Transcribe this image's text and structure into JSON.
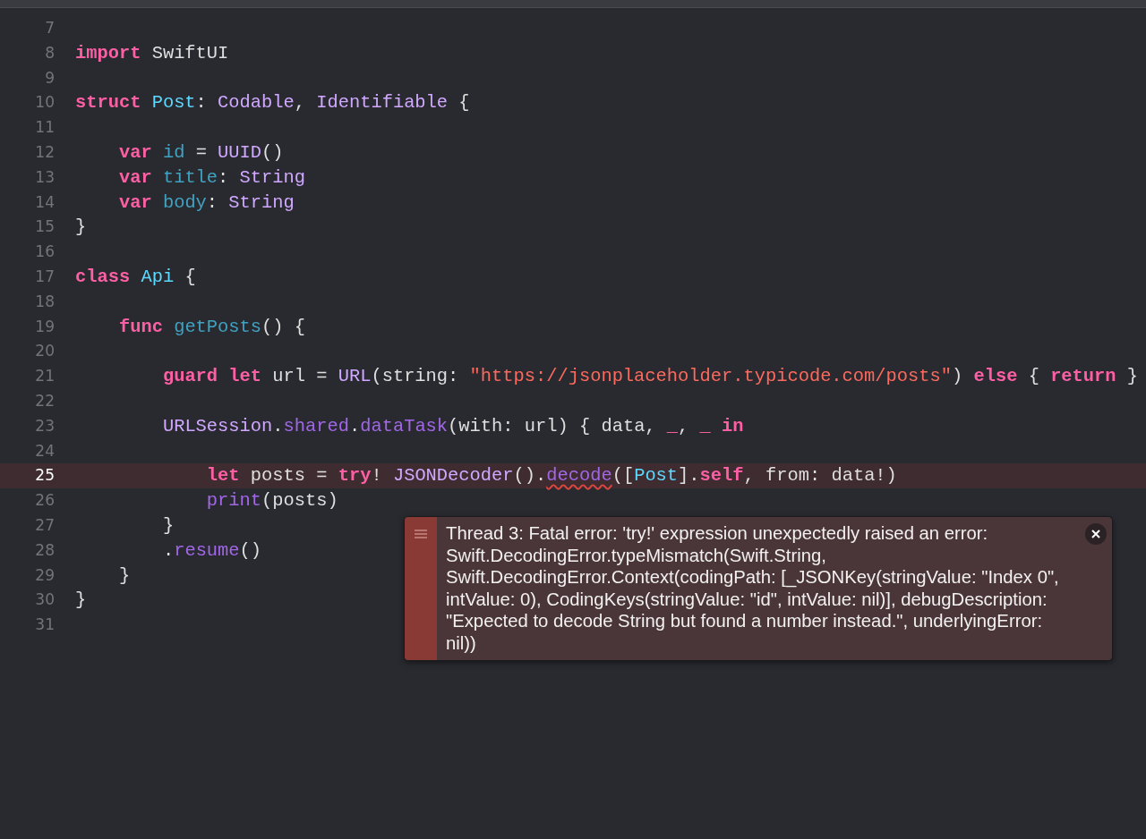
{
  "editor": {
    "lines": [
      {
        "number": "7",
        "highlighted": false
      },
      {
        "number": "8",
        "highlighted": false,
        "tokens": [
          {
            "text": "import ",
            "kind": "kw"
          },
          {
            "text": "SwiftUI",
            "kind": "plain"
          }
        ]
      },
      {
        "number": "9",
        "highlighted": false
      },
      {
        "number": "10",
        "highlighted": false,
        "tokens": [
          {
            "text": "struct ",
            "kind": "kw"
          },
          {
            "text": "Post",
            "kind": "ptype"
          },
          {
            "text": ": ",
            "kind": "plain"
          },
          {
            "text": "Codable",
            "kind": "type"
          },
          {
            "text": ", ",
            "kind": "plain"
          },
          {
            "text": "Identifiable",
            "kind": "type"
          },
          {
            "text": " {",
            "kind": "plain"
          }
        ]
      },
      {
        "number": "11",
        "highlighted": false
      },
      {
        "number": "12",
        "highlighted": false,
        "tokens": [
          {
            "text": "    var ",
            "kind": "kw"
          },
          {
            "text": "id",
            "kind": "decl"
          },
          {
            "text": " = ",
            "kind": "plain"
          },
          {
            "text": "UUID",
            "kind": "type"
          },
          {
            "text": "()",
            "kind": "plain"
          }
        ]
      },
      {
        "number": "13",
        "highlighted": false,
        "tokens": [
          {
            "text": "    var ",
            "kind": "kw"
          },
          {
            "text": "title",
            "kind": "decl"
          },
          {
            "text": ": ",
            "kind": "plain"
          },
          {
            "text": "String",
            "kind": "type"
          }
        ]
      },
      {
        "number": "14",
        "highlighted": false,
        "tokens": [
          {
            "text": "    var ",
            "kind": "kw"
          },
          {
            "text": "body",
            "kind": "decl"
          },
          {
            "text": ": ",
            "kind": "plain"
          },
          {
            "text": "String",
            "kind": "type"
          }
        ]
      },
      {
        "number": "15",
        "highlighted": false,
        "tokens": [
          {
            "text": "}",
            "kind": "plain"
          }
        ]
      },
      {
        "number": "16",
        "highlighted": false
      },
      {
        "number": "17",
        "highlighted": false,
        "tokens": [
          {
            "text": "class ",
            "kind": "kw"
          },
          {
            "text": "Api",
            "kind": "ptype"
          },
          {
            "text": " {",
            "kind": "plain"
          }
        ]
      },
      {
        "number": "18",
        "highlighted": false
      },
      {
        "number": "19",
        "highlighted": false,
        "tokens": [
          {
            "text": "    func ",
            "kind": "kw"
          },
          {
            "text": "getPosts",
            "kind": "decl"
          },
          {
            "text": "() {",
            "kind": "plain"
          }
        ]
      },
      {
        "number": "20",
        "highlighted": false
      },
      {
        "number": "21",
        "highlighted": false,
        "tokens": [
          {
            "text": "        guard let",
            "kind": "kw"
          },
          {
            "text": " url = ",
            "kind": "plain"
          },
          {
            "text": "URL",
            "kind": "type"
          },
          {
            "text": "(string: ",
            "kind": "plain"
          },
          {
            "text": "\"https://jsonplaceholder.typicode.com/posts\"",
            "kind": "str"
          },
          {
            "text": ") ",
            "kind": "plain"
          },
          {
            "text": "else",
            "kind": "kw"
          },
          {
            "text": " { ",
            "kind": "plain"
          },
          {
            "text": "return",
            "kind": "kw"
          },
          {
            "text": " }",
            "kind": "plain"
          }
        ]
      },
      {
        "number": "22",
        "highlighted": false
      },
      {
        "number": "23",
        "highlighted": false,
        "tokens": [
          {
            "text": "        URLSession",
            "kind": "type"
          },
          {
            "text": ".",
            "kind": "plain"
          },
          {
            "text": "shared",
            "kind": "method"
          },
          {
            "text": ".",
            "kind": "plain"
          },
          {
            "text": "dataTask",
            "kind": "method"
          },
          {
            "text": "(with: url) { data, ",
            "kind": "plain"
          },
          {
            "text": "_",
            "kind": "kw"
          },
          {
            "text": ", ",
            "kind": "plain"
          },
          {
            "text": "_ in",
            "kind": "kw"
          }
        ]
      },
      {
        "number": "24",
        "highlighted": false
      },
      {
        "number": "25",
        "highlighted": true,
        "tokens": [
          {
            "text": "            let",
            "kind": "kw"
          },
          {
            "text": " posts = ",
            "kind": "plain"
          },
          {
            "text": "try",
            "kind": "kw"
          },
          {
            "text": "! ",
            "kind": "plain"
          },
          {
            "text": "JSONDecoder",
            "kind": "type"
          },
          {
            "text": "().",
            "kind": "plain"
          },
          {
            "text": "decode",
            "kind": "method",
            "flagged": true
          },
          {
            "text": "([",
            "kind": "plain"
          },
          {
            "text": "Post",
            "kind": "ptype"
          },
          {
            "text": "].",
            "kind": "plain"
          },
          {
            "text": "self",
            "kind": "kw"
          },
          {
            "text": ", from: data!)",
            "kind": "plain"
          }
        ]
      },
      {
        "number": "26",
        "highlighted": false,
        "tokens": [
          {
            "text": "            print",
            "kind": "method"
          },
          {
            "text": "(posts)",
            "kind": "plain"
          }
        ]
      },
      {
        "number": "27",
        "highlighted": false,
        "tokens": [
          {
            "text": "        }",
            "kind": "plain"
          }
        ]
      },
      {
        "number": "28",
        "highlighted": false,
        "tokens": [
          {
            "text": "        .",
            "kind": "plain"
          },
          {
            "text": "resume",
            "kind": "method"
          },
          {
            "text": "()",
            "kind": "plain"
          }
        ]
      },
      {
        "number": "29",
        "highlighted": false,
        "tokens": [
          {
            "text": "    }",
            "kind": "plain"
          }
        ]
      },
      {
        "number": "30",
        "highlighted": false,
        "tokens": [
          {
            "text": "}",
            "kind": "plain"
          }
        ]
      },
      {
        "number": "31",
        "highlighted": false
      }
    ]
  },
  "error_popup": {
    "message": "Thread 3: Fatal error: 'try!' expression unexpectedly raised an error: Swift.DecodingError.typeMismatch(Swift.String, Swift.DecodingError.Context(codingPath: [_JSONKey(stringValue: \"Index 0\", intValue: 0), CodingKeys(stringValue: \"id\", intValue: nil)], debugDescription: \"Expected to decode String but found a number instead.\", underlyingError: nil))"
  }
}
